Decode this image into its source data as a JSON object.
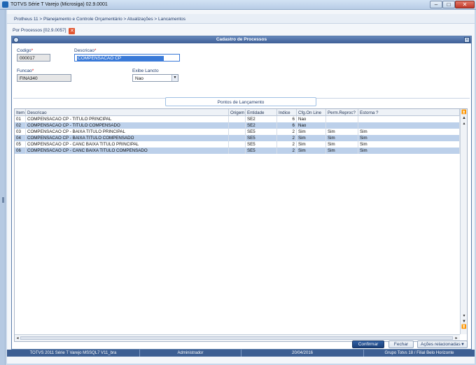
{
  "window": {
    "title": "TOTVS Série T Varejo (Microsiga) 02.9.0001",
    "min_label": "–",
    "max_label": "□",
    "close_label": "✕"
  },
  "breadcrumb": "Protheus 11 > Planejamento e Controle Orçamentário > Atualizações > Lancamentos",
  "tab": {
    "label": "Por Processos [02.9.0057]",
    "close_label": "✕"
  },
  "panel": {
    "title": "Cadastro de Processos",
    "collapse_label": "»",
    "fields": {
      "codigo": {
        "label": "Codigo",
        "value": "000017"
      },
      "descricao": {
        "label": "Descricao",
        "value": "COMPENSACAO CP"
      },
      "funcao": {
        "label": "Funcao",
        "value": "FINA340"
      },
      "exibe_lancto": {
        "label": "Exibe Lancto",
        "value": "Nao"
      }
    },
    "section_tab": "Pontos de Lançamento"
  },
  "grid": {
    "columns": [
      "Item",
      "Descricao",
      "Origem",
      "Entidade",
      "Indice",
      "Cfg.On Line",
      "Perm.Reproc?",
      "Estorna ?"
    ],
    "rows": [
      [
        "01",
        "COMPENSACAO CP - TITULO PRINCIPAL",
        "",
        "SE2",
        "6",
        "Nao",
        "",
        ""
      ],
      [
        "02",
        "COMPENSACAO CP - TITULO COMPENSADO",
        "",
        "SE2",
        "6",
        "Nao",
        "",
        ""
      ],
      [
        "03",
        "COMPENSACAO CP - BAIXA TITULO PRINCIPAL",
        "",
        "SE5",
        "2",
        "Sim",
        "Sim",
        "Sim"
      ],
      [
        "04",
        "COMPENSACAO CP - BAIXA TITULO COMPENSADO",
        "",
        "SE5",
        "2",
        "Sim",
        "Sim",
        "Sim"
      ],
      [
        "05",
        "COMPENSACAO CP - CANC BAIXA TITULO PRINCIPAL",
        "",
        "SE5",
        "2",
        "Sim",
        "Sim",
        "Sim"
      ],
      [
        "06",
        "COMPENSACAO CP - CANC BAIXA TITULO COMPENSADO",
        "",
        "SE5",
        "2",
        "Sim",
        "Sim",
        "Sim"
      ]
    ]
  },
  "buttons": {
    "confirm": "Confirmar",
    "close": "Fechar",
    "actions": "Ações relacionadas"
  },
  "status": {
    "version": "TOTVS 2011 Série T Varejo MSSQL7 V11_bra",
    "user": "Administrador",
    "date": "20/04/2016",
    "company": "Grupo Totvs 18 / Filial Belo Horizonte"
  }
}
